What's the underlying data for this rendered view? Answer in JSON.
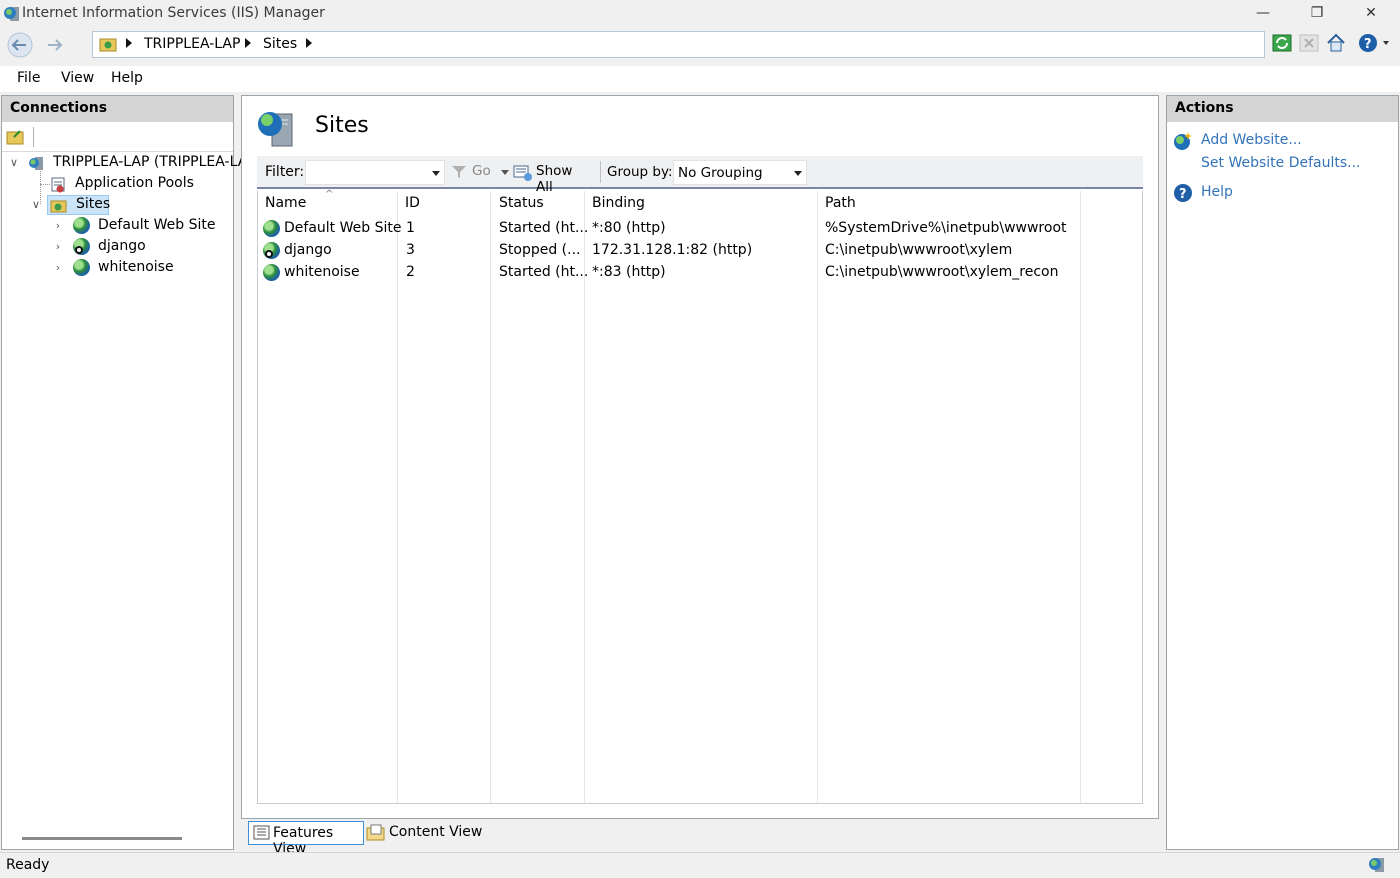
{
  "window": {
    "title": "Internet Information Services (IIS) Manager",
    "controls": [
      "—",
      "❐",
      "✕"
    ]
  },
  "address": {
    "crumbs": [
      "TRIPPLEA-LAP",
      "Sites"
    ]
  },
  "menu": [
    "File",
    "View",
    "Help"
  ],
  "connections": {
    "header": "Connections",
    "tree": [
      {
        "label": "TRIPPLEA-LAP (TRIPPLEA-LAP",
        "expander": "∨"
      },
      {
        "label": "Application Pools",
        "expander": ""
      },
      {
        "label": "Sites",
        "expander": "∨"
      },
      {
        "label": "Default Web Site",
        "expander": "›"
      },
      {
        "label": "django",
        "expander": "›"
      },
      {
        "label": "whitenoise",
        "expander": "›"
      }
    ]
  },
  "main": {
    "title": "Sites",
    "filter_label": "Filter:",
    "filter_value": "",
    "go_label": "Go",
    "show_all_label": "Show All",
    "group_by_label": "Group by:",
    "group_by_value": "No Grouping",
    "columns": [
      "Name",
      "ID",
      "Status",
      "Binding",
      "Path"
    ],
    "rows": [
      {
        "name": "Default Web Site",
        "id": "1",
        "status": "Started (ht...",
        "binding": "*:80 (http)",
        "path": "%SystemDrive%\\inetpub\\wwwroot"
      },
      {
        "name": "django",
        "id": "3",
        "status": "Stopped (...",
        "binding": "172.31.128.1:82 (http)",
        "path": "C:\\inetpub\\wwwroot\\xylem"
      },
      {
        "name": "whitenoise",
        "id": "2",
        "status": "Started (ht...",
        "binding": "*:83 (http)",
        "path": "C:\\inetpub\\wwwroot\\xylem_recon"
      }
    ]
  },
  "actions": {
    "header": "Actions",
    "add_website": "Add Website...",
    "set_defaults": "Set Website Defaults...",
    "help": "Help"
  },
  "view_tabs": {
    "features": "Features View",
    "content": "Content View"
  },
  "status": {
    "text": "Ready"
  },
  "colors": {
    "link": "#3373b9",
    "panel_header": "#d4d4d4",
    "selected_tree": "#cce4f7"
  }
}
